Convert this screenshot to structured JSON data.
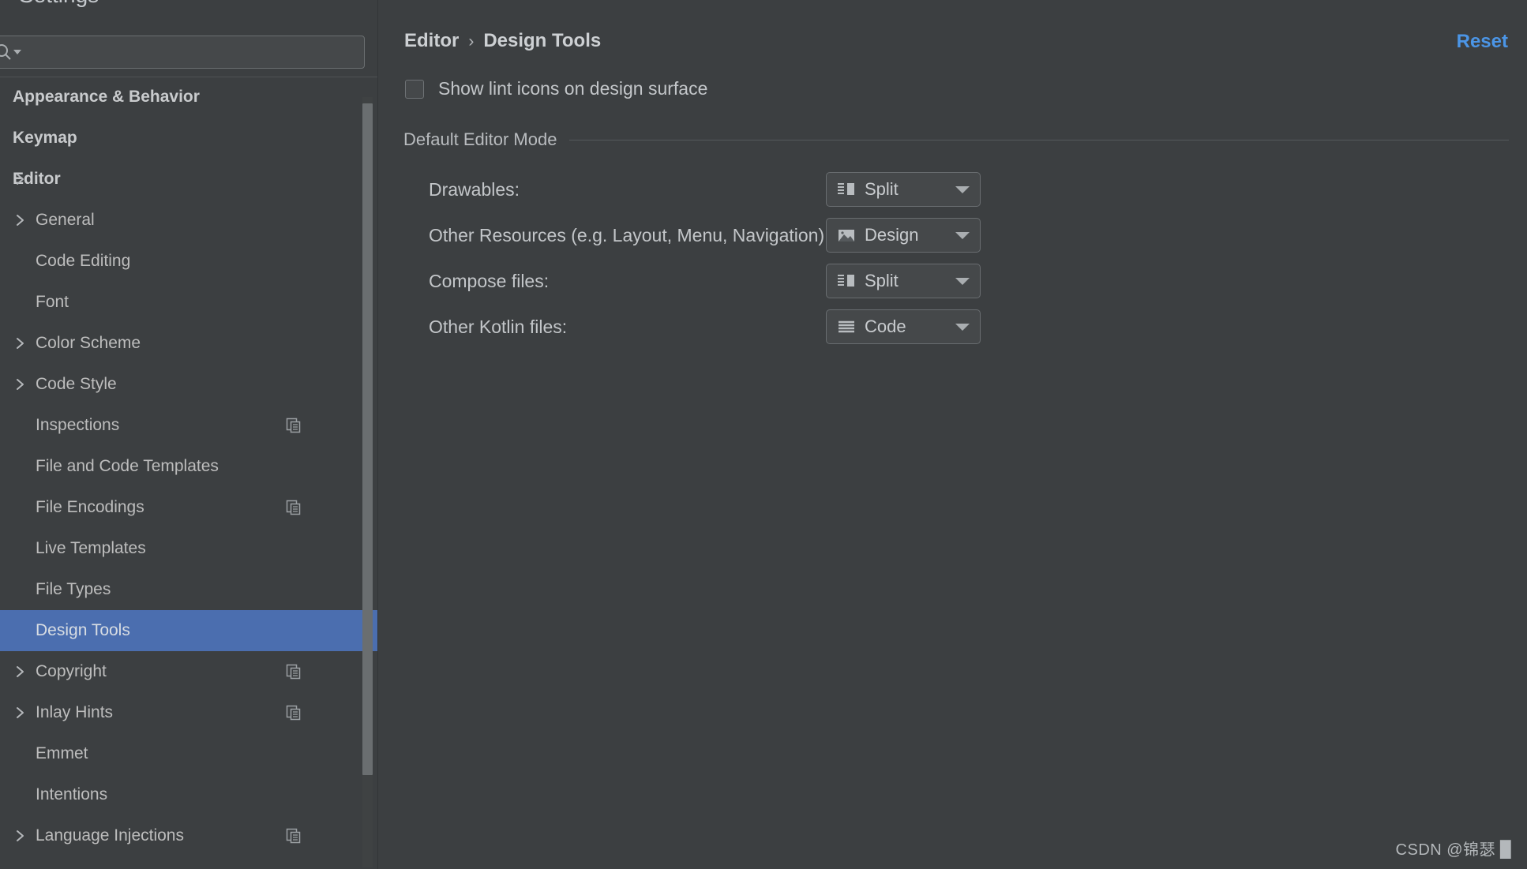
{
  "window": {
    "title": "Settings",
    "close_icon": "close-icon"
  },
  "search": {
    "value": "",
    "placeholder": "",
    "icon": "search-icon"
  },
  "sidebar": {
    "items": [
      {
        "label": "Appearance & Behavior",
        "level": 0,
        "arrow": false,
        "copy": false,
        "selected": false
      },
      {
        "label": "Keymap",
        "level": 0,
        "arrow": false,
        "copy": false,
        "selected": false
      },
      {
        "label": "Editor",
        "level": 0,
        "arrow": true,
        "copy": false,
        "selected": false
      },
      {
        "label": "General",
        "level": 1,
        "arrow": true,
        "copy": false,
        "selected": false
      },
      {
        "label": "Code Editing",
        "level": 1,
        "arrow": false,
        "copy": false,
        "selected": false
      },
      {
        "label": "Font",
        "level": 1,
        "arrow": false,
        "copy": false,
        "selected": false
      },
      {
        "label": "Color Scheme",
        "level": 1,
        "arrow": true,
        "copy": false,
        "selected": false
      },
      {
        "label": "Code Style",
        "level": 1,
        "arrow": true,
        "copy": false,
        "selected": false
      },
      {
        "label": "Inspections",
        "level": 1,
        "arrow": false,
        "copy": true,
        "selected": false
      },
      {
        "label": "File and Code Templates",
        "level": 1,
        "arrow": false,
        "copy": false,
        "selected": false
      },
      {
        "label": "File Encodings",
        "level": 1,
        "arrow": false,
        "copy": true,
        "selected": false
      },
      {
        "label": "Live Templates",
        "level": 1,
        "arrow": false,
        "copy": false,
        "selected": false
      },
      {
        "label": "File Types",
        "level": 1,
        "arrow": false,
        "copy": false,
        "selected": false
      },
      {
        "label": "Design Tools",
        "level": 1,
        "arrow": false,
        "copy": false,
        "selected": true
      },
      {
        "label": "Copyright",
        "level": 1,
        "arrow": true,
        "copy": true,
        "selected": false
      },
      {
        "label": "Inlay Hints",
        "level": 1,
        "arrow": true,
        "copy": true,
        "selected": false
      },
      {
        "label": "Emmet",
        "level": 1,
        "arrow": false,
        "copy": false,
        "selected": false
      },
      {
        "label": "Intentions",
        "level": 1,
        "arrow": false,
        "copy": false,
        "selected": false
      },
      {
        "label": "Language Injections",
        "level": 1,
        "arrow": true,
        "copy": true,
        "selected": false
      }
    ]
  },
  "main": {
    "breadcrumb": {
      "parent": "Editor",
      "separator": "›",
      "current": "Design Tools"
    },
    "reset_label": "Reset",
    "lint_checkbox": {
      "label": "Show lint icons on design surface",
      "checked": false
    },
    "section": {
      "title": "Default Editor Mode",
      "rows": [
        {
          "label": "Drawables:",
          "value": "Split",
          "icon": "split-view-icon"
        },
        {
          "label": "Other Resources (e.g. Layout, Menu, Navigation):",
          "value": "Design",
          "icon": "design-view-icon"
        },
        {
          "label": "Compose files:",
          "value": "Split",
          "icon": "split-view-icon"
        },
        {
          "label": "Other Kotlin files:",
          "value": "Code",
          "icon": "code-view-icon"
        }
      ]
    }
  },
  "watermark": "CSDN @锦瑟 ▉",
  "colors": {
    "background": "#3c3f41",
    "selection": "#4b6eaf",
    "accent_link": "#4b95e6",
    "text": "#c3c6c9",
    "border": "#696d70"
  }
}
